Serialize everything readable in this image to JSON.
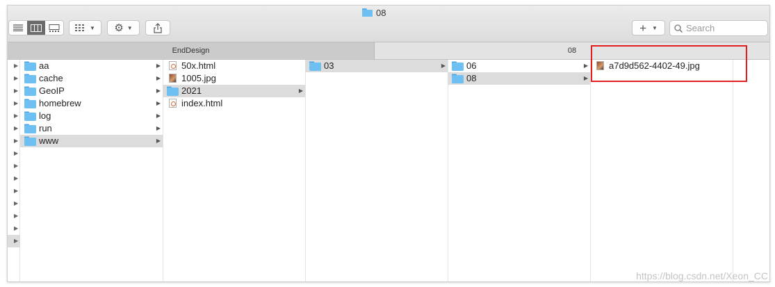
{
  "window": {
    "title": "08"
  },
  "toolbar": {
    "view_buttons": [
      "list-view",
      "column-view",
      "gallery-view"
    ],
    "group_button": "group-by",
    "action_button": "action-menu",
    "share_button": "share",
    "new_button": "+",
    "search": {
      "placeholder": "Search"
    }
  },
  "pathbar": {
    "left": "EndDesign",
    "right": "08"
  },
  "columns": [
    {
      "items": [
        {
          "name": "aa",
          "type": "folder",
          "selected": false
        },
        {
          "name": "cache",
          "type": "folder",
          "selected": false
        },
        {
          "name": "GeoIP",
          "type": "folder",
          "selected": false
        },
        {
          "name": "homebrew",
          "type": "folder",
          "selected": false
        },
        {
          "name": "log",
          "type": "folder",
          "selected": false
        },
        {
          "name": "run",
          "type": "folder",
          "selected": false
        },
        {
          "name": "www",
          "type": "folder",
          "selected": true
        }
      ]
    },
    {
      "items": [
        {
          "name": "50x.html",
          "type": "html",
          "selected": false
        },
        {
          "name": "1005.jpg",
          "type": "image",
          "selected": false
        },
        {
          "name": "2021",
          "type": "folder",
          "selected": true
        },
        {
          "name": "index.html",
          "type": "html",
          "selected": false
        }
      ]
    },
    {
      "items": [
        {
          "name": "03",
          "type": "folder",
          "selected": true
        }
      ]
    },
    {
      "items": [
        {
          "name": "06",
          "type": "folder",
          "selected": false
        },
        {
          "name": "08",
          "type": "folder",
          "selected": true
        }
      ]
    },
    {
      "items": [
        {
          "name": "a7d9d562-4402-49.jpg",
          "type": "image",
          "selected": false
        }
      ]
    }
  ],
  "watermark": "https://blog.csdn.net/Xeon_CC",
  "colors": {
    "folder": "#6ec0f2",
    "selection": "#dcdcdc",
    "highlight_box": "#e41e1e"
  }
}
